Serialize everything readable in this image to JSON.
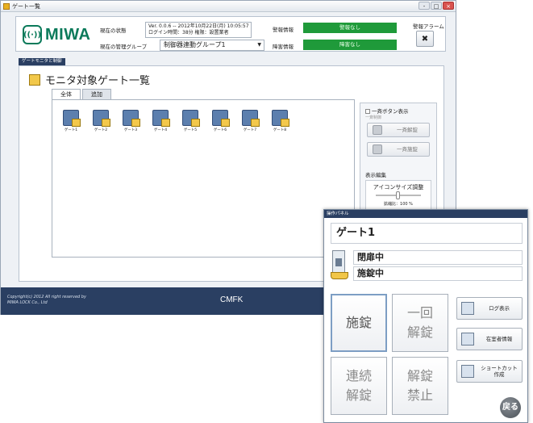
{
  "window": {
    "title": "ゲート一覧",
    "controls": [
      "-",
      "□",
      "×"
    ]
  },
  "header": {
    "logo": "MIWA",
    "status_label": "現在の状態",
    "version_line": "Ver. 0.0.6  --  2012年10月22日(月) 10:05:57",
    "login_line": "ログイン時間：38分  権限：設置業者",
    "group_label": "現在の管理グループ",
    "group_value": "制御器連動グループ1",
    "alarm_info_label": "警報情報",
    "alarm_info_value": "警報なし",
    "fault_info_label": "障害情報",
    "fault_info_value": "障害なし",
    "alarm_button_label": "警報アラーム",
    "status_color": "#1f9a3a"
  },
  "section_tab": "ゲートモニタと制御",
  "page_title": "モニタ対象ゲート一覧",
  "tabs": [
    "全体",
    "追加"
  ],
  "gates": [
    "ゲート1",
    "ゲート2",
    "ゲート3",
    "ゲート4",
    "ゲート5",
    "ゲート6",
    "ゲート7",
    "ゲート8"
  ],
  "side_panel": {
    "bulk_checkbox": "一斉ボタン表示",
    "bulk_sub": "一斉制御",
    "unlock_all": "一斉解錠",
    "lock_all": "一斉施錠",
    "display_label": "表示編集",
    "icon_size_label": "アイコンサイズ調整",
    "zoom_text": "拡縮比：100 %",
    "zoom_level_fraction": 0.5
  },
  "footer": {
    "copyright_1": "Copyright(c) 2012 All right reserved by",
    "copyright_2": "MIWA LOCK Co., Ltd",
    "product": "CMFK"
  },
  "op_panel": {
    "title": "操作パネル",
    "gate_name": "ゲート1",
    "door_status": "閉扉中",
    "lock_status": "施錠中",
    "buttons": {
      "lock": "施錠",
      "one_time_unlock": "一回\n解錠",
      "continuous_unlock": "連続\n解錠",
      "unlock_prohibit": "解錠\n禁止"
    },
    "log_view": "ログ表示",
    "presence_info": "在室者情報",
    "shortcut_create_1": "ショートカット",
    "shortcut_create_2": "作成",
    "back": "戻る"
  }
}
